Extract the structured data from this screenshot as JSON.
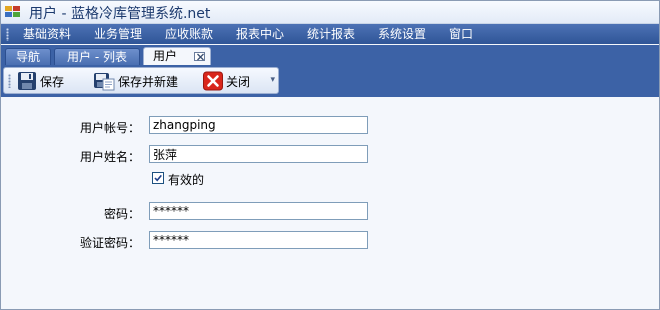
{
  "window": {
    "title": "用户 - 蓝格冷库管理系统.net"
  },
  "menu": [
    "基础资料",
    "业务管理",
    "应收账款",
    "报表中心",
    "统计报表",
    "系统设置",
    "窗口"
  ],
  "tabs": [
    {
      "label": "导航",
      "active": false
    },
    {
      "label": "用户 - 列表",
      "active": false
    },
    {
      "label": "用户",
      "active": true
    }
  ],
  "toolbar": {
    "save_label": "保存",
    "save_new_label": "保存并新建",
    "close_label": "关闭"
  },
  "form": {
    "account_label": "用户帐号：",
    "account_value": "zhangping",
    "name_label": "用户姓名：",
    "name_value": "张萍",
    "active_label": "有效的",
    "active_checked": true,
    "password_label": "密码：",
    "password_value": "******",
    "confirm_label": "验证密码：",
    "confirm_value": "******"
  },
  "colors": {
    "menu_bar": "#2f5597",
    "tab_strip": "#3c62a6",
    "body_bg": "#f4f7fc",
    "close_icon": "#d9261c"
  },
  "icons": [
    "app-icon",
    "save-icon",
    "save-new-icon",
    "close-icon"
  ]
}
